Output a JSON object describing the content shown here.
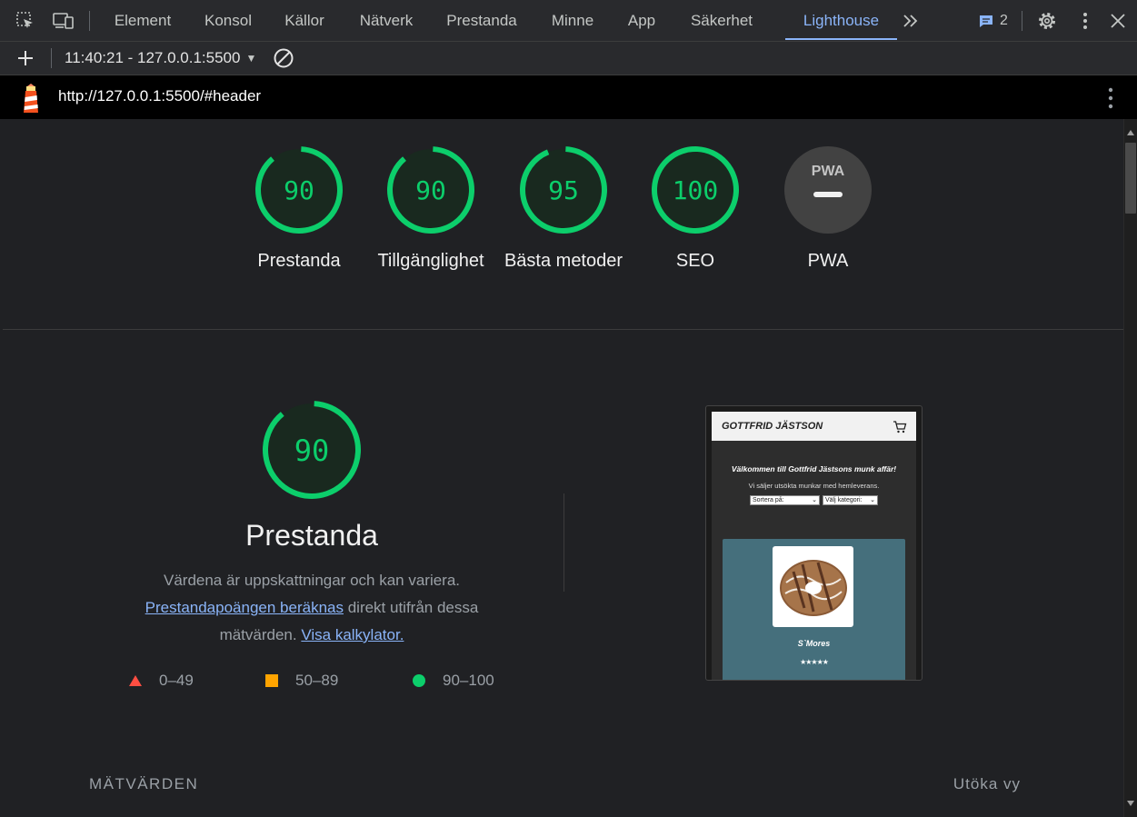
{
  "devtools": {
    "tabs": [
      "Element",
      "Konsol",
      "Källor",
      "Nätverk",
      "Prestanda",
      "Minne",
      "App",
      "Säkerhet",
      "Lighthouse"
    ],
    "active_tab": "Lighthouse",
    "issues_count": "2"
  },
  "report": {
    "selected": "11:40:21 - 127.0.0.1:5500"
  },
  "urlbar": {
    "url": "http://127.0.0.1:5500/#header"
  },
  "gauges": [
    {
      "score": "90",
      "label": "Prestanda"
    },
    {
      "score": "90",
      "label": "Tillgänglighet"
    },
    {
      "score": "95",
      "label": "Bästa metoder"
    },
    {
      "score": "100",
      "label": "SEO"
    },
    {
      "score": "",
      "label": "PWA",
      "badge": "PWA"
    }
  ],
  "performance": {
    "score": "90",
    "title": "Prestanda",
    "desc_text1": "Värdena är uppskattningar och kan variera.",
    "desc_link1": "Prestandapoängen beräknas",
    "desc_text2": " direkt utifrån dessa mätvärden.",
    "desc_link2": "Visa kalkylator."
  },
  "legend": [
    {
      "range": "0–49",
      "color": "#ff4e42"
    },
    {
      "range": "50–89",
      "color": "#ffa400"
    },
    {
      "range": "90–100",
      "color": "#0cce6b"
    }
  ],
  "metrics": {
    "title": "MÄTVÄRDEN",
    "expand": "Utöka vy"
  },
  "thumbnail": {
    "brand": "GOTTFRID JÄSTSON",
    "welcome": "Välkommen till Gottfrid Jästsons munk affär!",
    "subtitle": "Vi säljer utsökta munkar med hemleverans.",
    "sort_placeholder": "Sortera på:",
    "category_placeholder": "Välj kategori:",
    "product_name": "S`Mores",
    "stars": "★★★★★"
  },
  "colors": {
    "pass": "#0cce6b",
    "accent": "#8ab4f8"
  }
}
